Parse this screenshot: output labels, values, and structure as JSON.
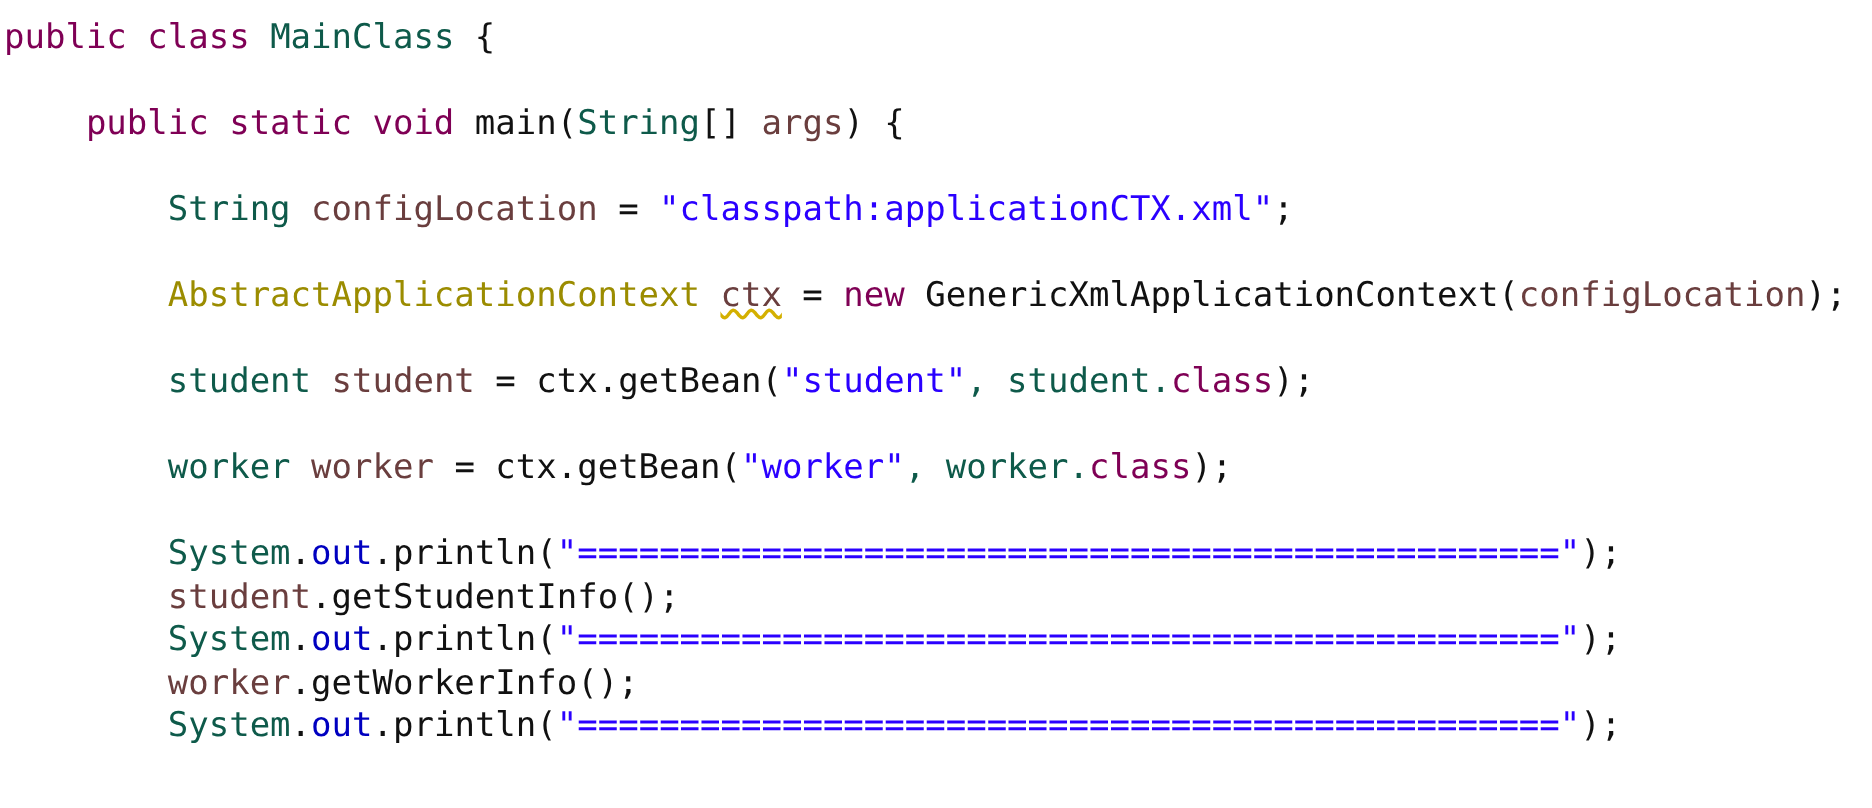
{
  "code": [
    {
      "tokens": [
        {
          "text": "public class ",
          "kind": "keyword"
        },
        {
          "text": "MainClass",
          "kind": "type"
        },
        {
          "text": " {",
          "kind": "plain"
        }
      ],
      "children": [
        {
          "tokens": [
            {
              "text": "public static void ",
              "kind": "keyword"
            },
            {
              "text": "main(",
              "kind": "plain"
            },
            {
              "text": "String",
              "kind": "type"
            },
            {
              "text": "[] ",
              "kind": "plain"
            },
            {
              "text": "args",
              "kind": "variable"
            },
            {
              "text": ") {",
              "kind": "plain"
            }
          ],
          "groups": [
            [
              {
                "tokens": [
                  {
                    "text": "String ",
                    "kind": "type"
                  },
                  {
                    "text": "configLocation",
                    "kind": "variable"
                  },
                  {
                    "text": " = ",
                    "kind": "plain"
                  },
                  {
                    "text": "\"classpath:applicationCTX.xml\"",
                    "kind": "string"
                  },
                  {
                    "text": ";",
                    "kind": "plain"
                  }
                ]
              }
            ],
            [
              {
                "tokens": [
                  {
                    "text": "AbstractApplicationContext ",
                    "kind": "deprecated"
                  },
                  {
                    "text": "ctx",
                    "kind": "warning"
                  },
                  {
                    "text": " = ",
                    "kind": "plain"
                  },
                  {
                    "text": "new",
                    "kind": "keyword"
                  },
                  {
                    "text": " GenericXmlApplicationContext(",
                    "kind": "plain"
                  },
                  {
                    "text": "configLocation",
                    "kind": "variable"
                  },
                  {
                    "text": ");",
                    "kind": "plain"
                  }
                ]
              }
            ],
            [
              {
                "tokens": [
                  {
                    "text": "student ",
                    "kind": "type"
                  },
                  {
                    "text": "student",
                    "kind": "variable"
                  },
                  {
                    "text": " = ctx.getBean(",
                    "kind": "plain"
                  },
                  {
                    "text": "\"student\"",
                    "kind": "string"
                  },
                  {
                    "text": ", student.",
                    "kind": "type"
                  },
                  {
                    "text": "class",
                    "kind": "keyword"
                  },
                  {
                    "text": ");",
                    "kind": "plain"
                  }
                ]
              }
            ],
            [
              {
                "tokens": [
                  {
                    "text": "worker ",
                    "kind": "type"
                  },
                  {
                    "text": "worker",
                    "kind": "variable"
                  },
                  {
                    "text": " = ctx.getBean(",
                    "kind": "plain"
                  },
                  {
                    "text": "\"worker\"",
                    "kind": "string"
                  },
                  {
                    "text": ", worker.",
                    "kind": "type"
                  },
                  {
                    "text": "class",
                    "kind": "keyword"
                  },
                  {
                    "text": ");",
                    "kind": "plain"
                  }
                ]
              }
            ],
            [
              {
                "tokens": [
                  {
                    "text": "System",
                    "kind": "type"
                  },
                  {
                    "text": ".",
                    "kind": "plain"
                  },
                  {
                    "text": "out",
                    "kind": "field"
                  },
                  {
                    "text": ".println(",
                    "kind": "plain"
                  },
                  {
                    "text": "\"================================================\"",
                    "kind": "string"
                  },
                  {
                    "text": ");",
                    "kind": "plain"
                  }
                ]
              },
              {
                "tokens": [
                  {
                    "text": "student",
                    "kind": "variable"
                  },
                  {
                    "text": ".getStudentInfo();",
                    "kind": "plain"
                  }
                ]
              },
              {
                "tokens": [
                  {
                    "text": "System",
                    "kind": "type"
                  },
                  {
                    "text": ".",
                    "kind": "plain"
                  },
                  {
                    "text": "out",
                    "kind": "field"
                  },
                  {
                    "text": ".println(",
                    "kind": "plain"
                  },
                  {
                    "text": "\"================================================\"",
                    "kind": "string"
                  },
                  {
                    "text": ");",
                    "kind": "plain"
                  }
                ]
              },
              {
                "tokens": [
                  {
                    "text": "worker",
                    "kind": "variable"
                  },
                  {
                    "text": ".getWorkerInfo();",
                    "kind": "plain"
                  }
                ]
              },
              {
                "tokens": [
                  {
                    "text": "System",
                    "kind": "type"
                  },
                  {
                    "text": ".",
                    "kind": "plain"
                  },
                  {
                    "text": "out",
                    "kind": "field"
                  },
                  {
                    "text": ".println(",
                    "kind": "plain"
                  },
                  {
                    "text": "\"================================================\"",
                    "kind": "string"
                  },
                  {
                    "text": ");",
                    "kind": "plain"
                  }
                ]
              }
            ]
          ]
        }
      ]
    }
  ]
}
